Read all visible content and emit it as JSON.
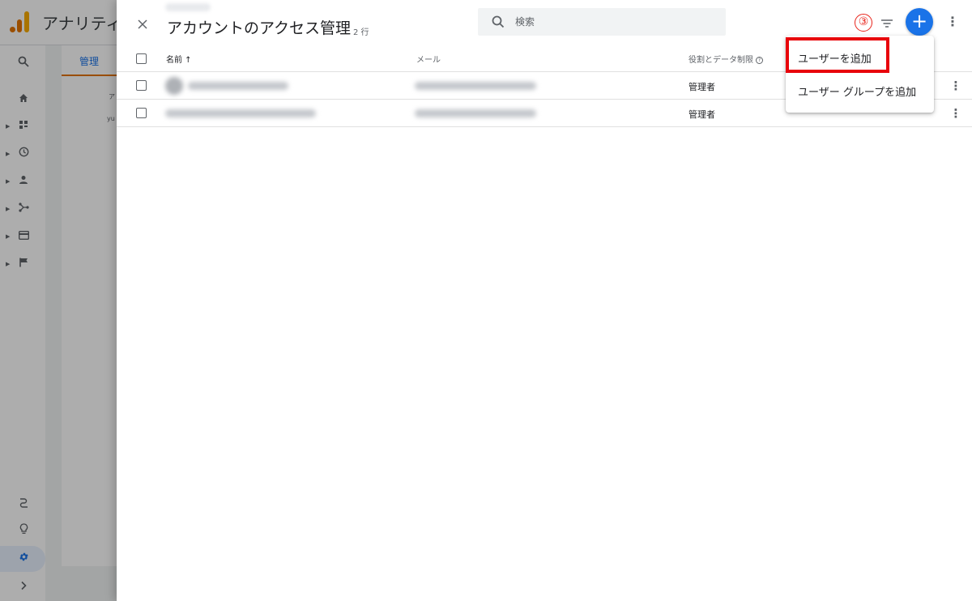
{
  "background": {
    "app_title": "アナリティ",
    "admin_tab": "管理",
    "card_letters": [
      "ア",
      "yu"
    ]
  },
  "panel": {
    "title": "アカウントのアクセス管理",
    "row_count": "2 行",
    "search_placeholder": "検索",
    "step_marker": "③",
    "add_symbol": "+",
    "more_symbol": "⋮"
  },
  "table": {
    "headers": {
      "name": "名前 ↑",
      "email": "メール",
      "role": "役割とデータ制限"
    },
    "rows": [
      {
        "role": "管理者"
      },
      {
        "role": "管理者"
      }
    ]
  },
  "menu": {
    "items": [
      {
        "label": "ユーザーを追加"
      },
      {
        "label": "ユーザー グループを追加"
      }
    ]
  },
  "colors": {
    "accent_blue": "#1a73e8",
    "highlight_red": "#e8040b",
    "brand_orange": "#e37400"
  }
}
